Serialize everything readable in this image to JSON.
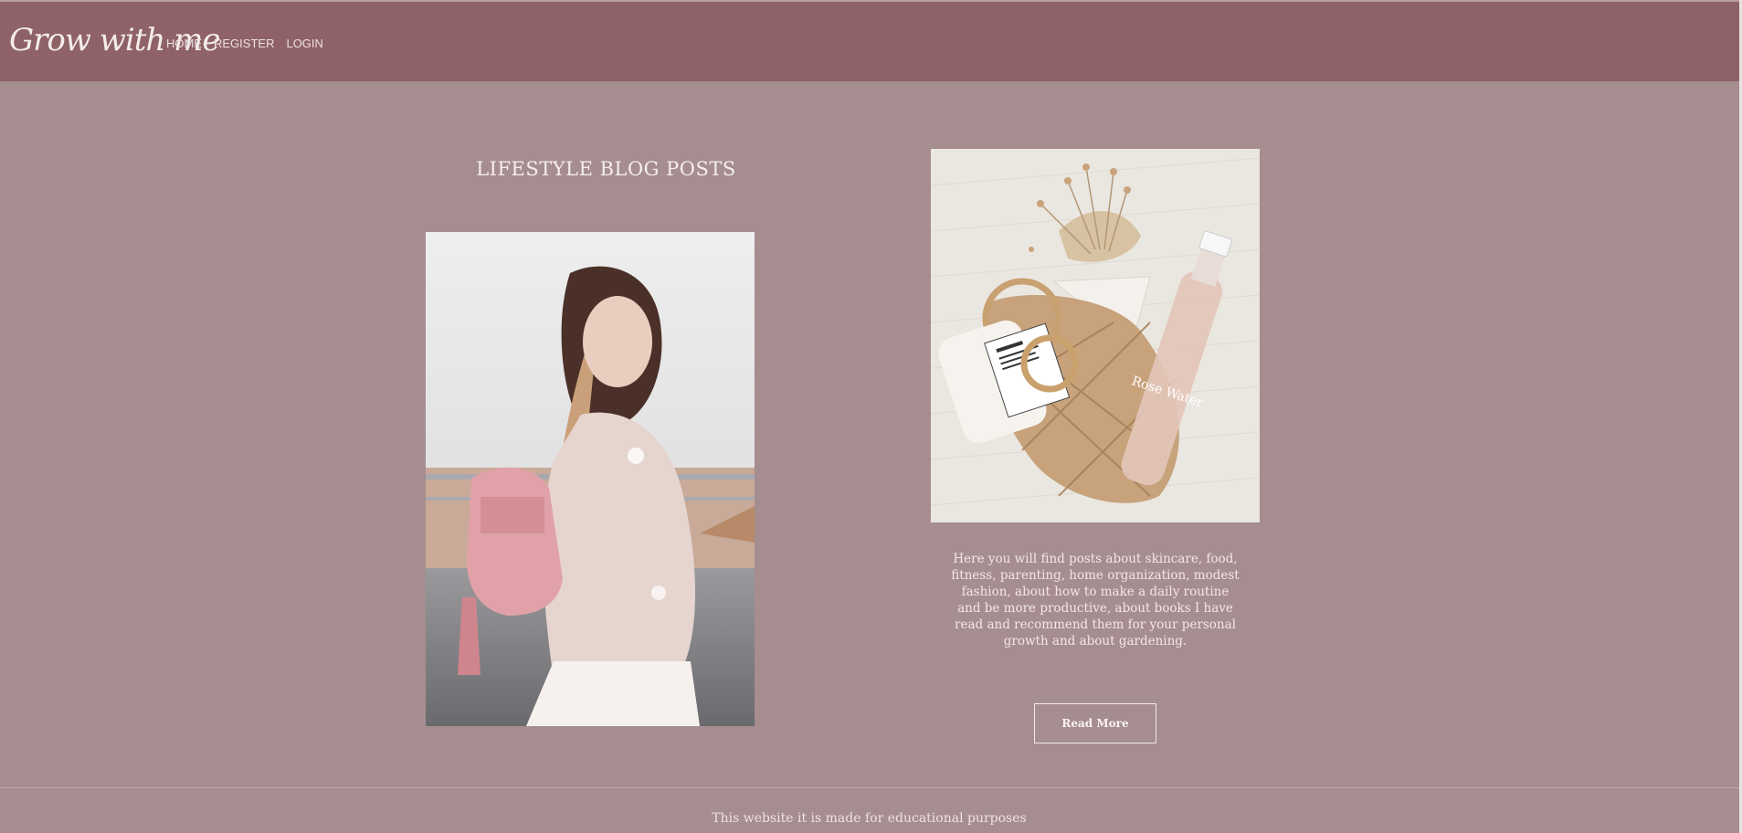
{
  "header": {
    "logo": "Grow with me",
    "nav": [
      "HOME",
      "REGISTER",
      "LOGIN"
    ]
  },
  "main": {
    "section_title": "LIFESTYLE BLOG POSTS",
    "description": "Here you will find posts about skincare, food, fitness, parenting, home organization, modest fashion, about how to make a daily routine and be more productive, about books I have read and recommend them for your personal growth and about gardening.",
    "button_label": "Read More",
    "product_label": "Rose Water"
  },
  "footer": {
    "text": "This website it is made for educational purposes"
  },
  "colors": {
    "header_bg": "#8e6266",
    "page_bg": "#a68d8f",
    "text_light": "#f3e9e9"
  }
}
